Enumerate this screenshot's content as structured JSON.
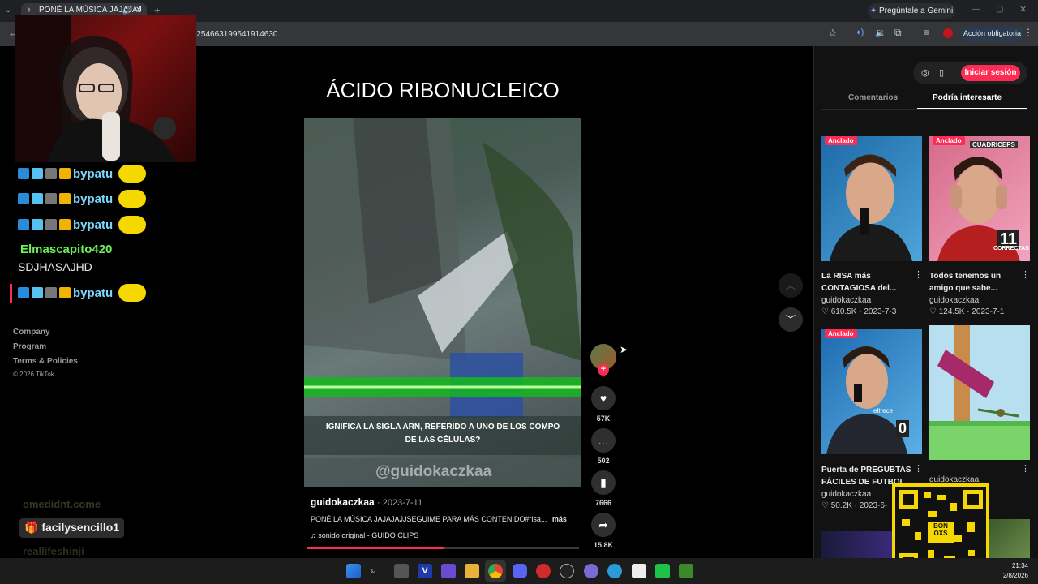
{
  "browser": {
    "tab_title": "PONÉ LA MÚSICA JAJAJAJ",
    "url": "/7254663199641914630",
    "gemini_label": "Pregúntale a Gemini",
    "action_label": "Acción obligatoria"
  },
  "chat": {
    "rows": [
      {
        "user": "bypatu"
      },
      {
        "user": "bypatu"
      },
      {
        "user": "bypatu"
      }
    ],
    "line_user": "Elmascapito420",
    "line_text": "SDJHASAJHD",
    "last_user": "bypatu",
    "ghost_users": [
      "omedidnt.come",
      "facilysencillo1",
      "reallifeshinji"
    ]
  },
  "footer": {
    "company": "Company",
    "program": "Program",
    "terms": "Terms & Policies",
    "copyright": "© 2026 TikTok"
  },
  "video": {
    "title": "ÁCIDO RIBONUCLEICO",
    "caption_overlay_1": "IGNIFICA LA SIGLA ARN, REFERIDO A UNO DE LOS COMPO",
    "caption_overlay_2": "DE LAS CÉLULAS?",
    "watermark": "@guidokaczkaa",
    "author": "guidokaczkaa",
    "date": "· 2023-7-11",
    "description": "PONÉ LA MÚSICA JAJAJAJJSEGUIME PARA MÁS CONTENIDO#risa...",
    "more": "más",
    "sound": "sonido original - GUIDO CLIPS",
    "likes": "57K",
    "comments": "502",
    "saves": "7666",
    "shares": "15.8K"
  },
  "right": {
    "login_button": "Iniciar sesión",
    "tab_comments": "Comentarios",
    "tab_interest": "Podría interesarte",
    "pinned_label": "Anclado",
    "videos": [
      {
        "title1": "La RISA más",
        "title2": "CONTAGIOSA del...",
        "author": "guidokaczkaa",
        "likes": "610.5K",
        "date": "2023-7-3",
        "overlay": ""
      },
      {
        "title1": "Todos tenemos un",
        "title2": "amigo que sabe...",
        "author": "guidokaczkaa",
        "likes": "124.5K",
        "date": "2023-7-1",
        "overlay": "11"
      },
      {
        "title1": "Puerta de PREGUBTAS",
        "title2": "FÁCILES DE FUTBOL",
        "author": "guidokaczkaa",
        "likes": "50.2K",
        "date": "2023-6-",
        "overlay": "0"
      },
      {
        "title1": "",
        "title2": "",
        "author": "guidokaczkaa",
        "likes": "",
        "date": "",
        "overlay": ""
      }
    ],
    "thumb_small_1": "CORRECTAS",
    "thumb_top_2": "CUADRICEPS",
    "thumb_corner": "eltrece"
  },
  "taskbar": {
    "time": "21:34",
    "date": "2/8/2026"
  },
  "qr": {
    "label": "BON OXS"
  }
}
